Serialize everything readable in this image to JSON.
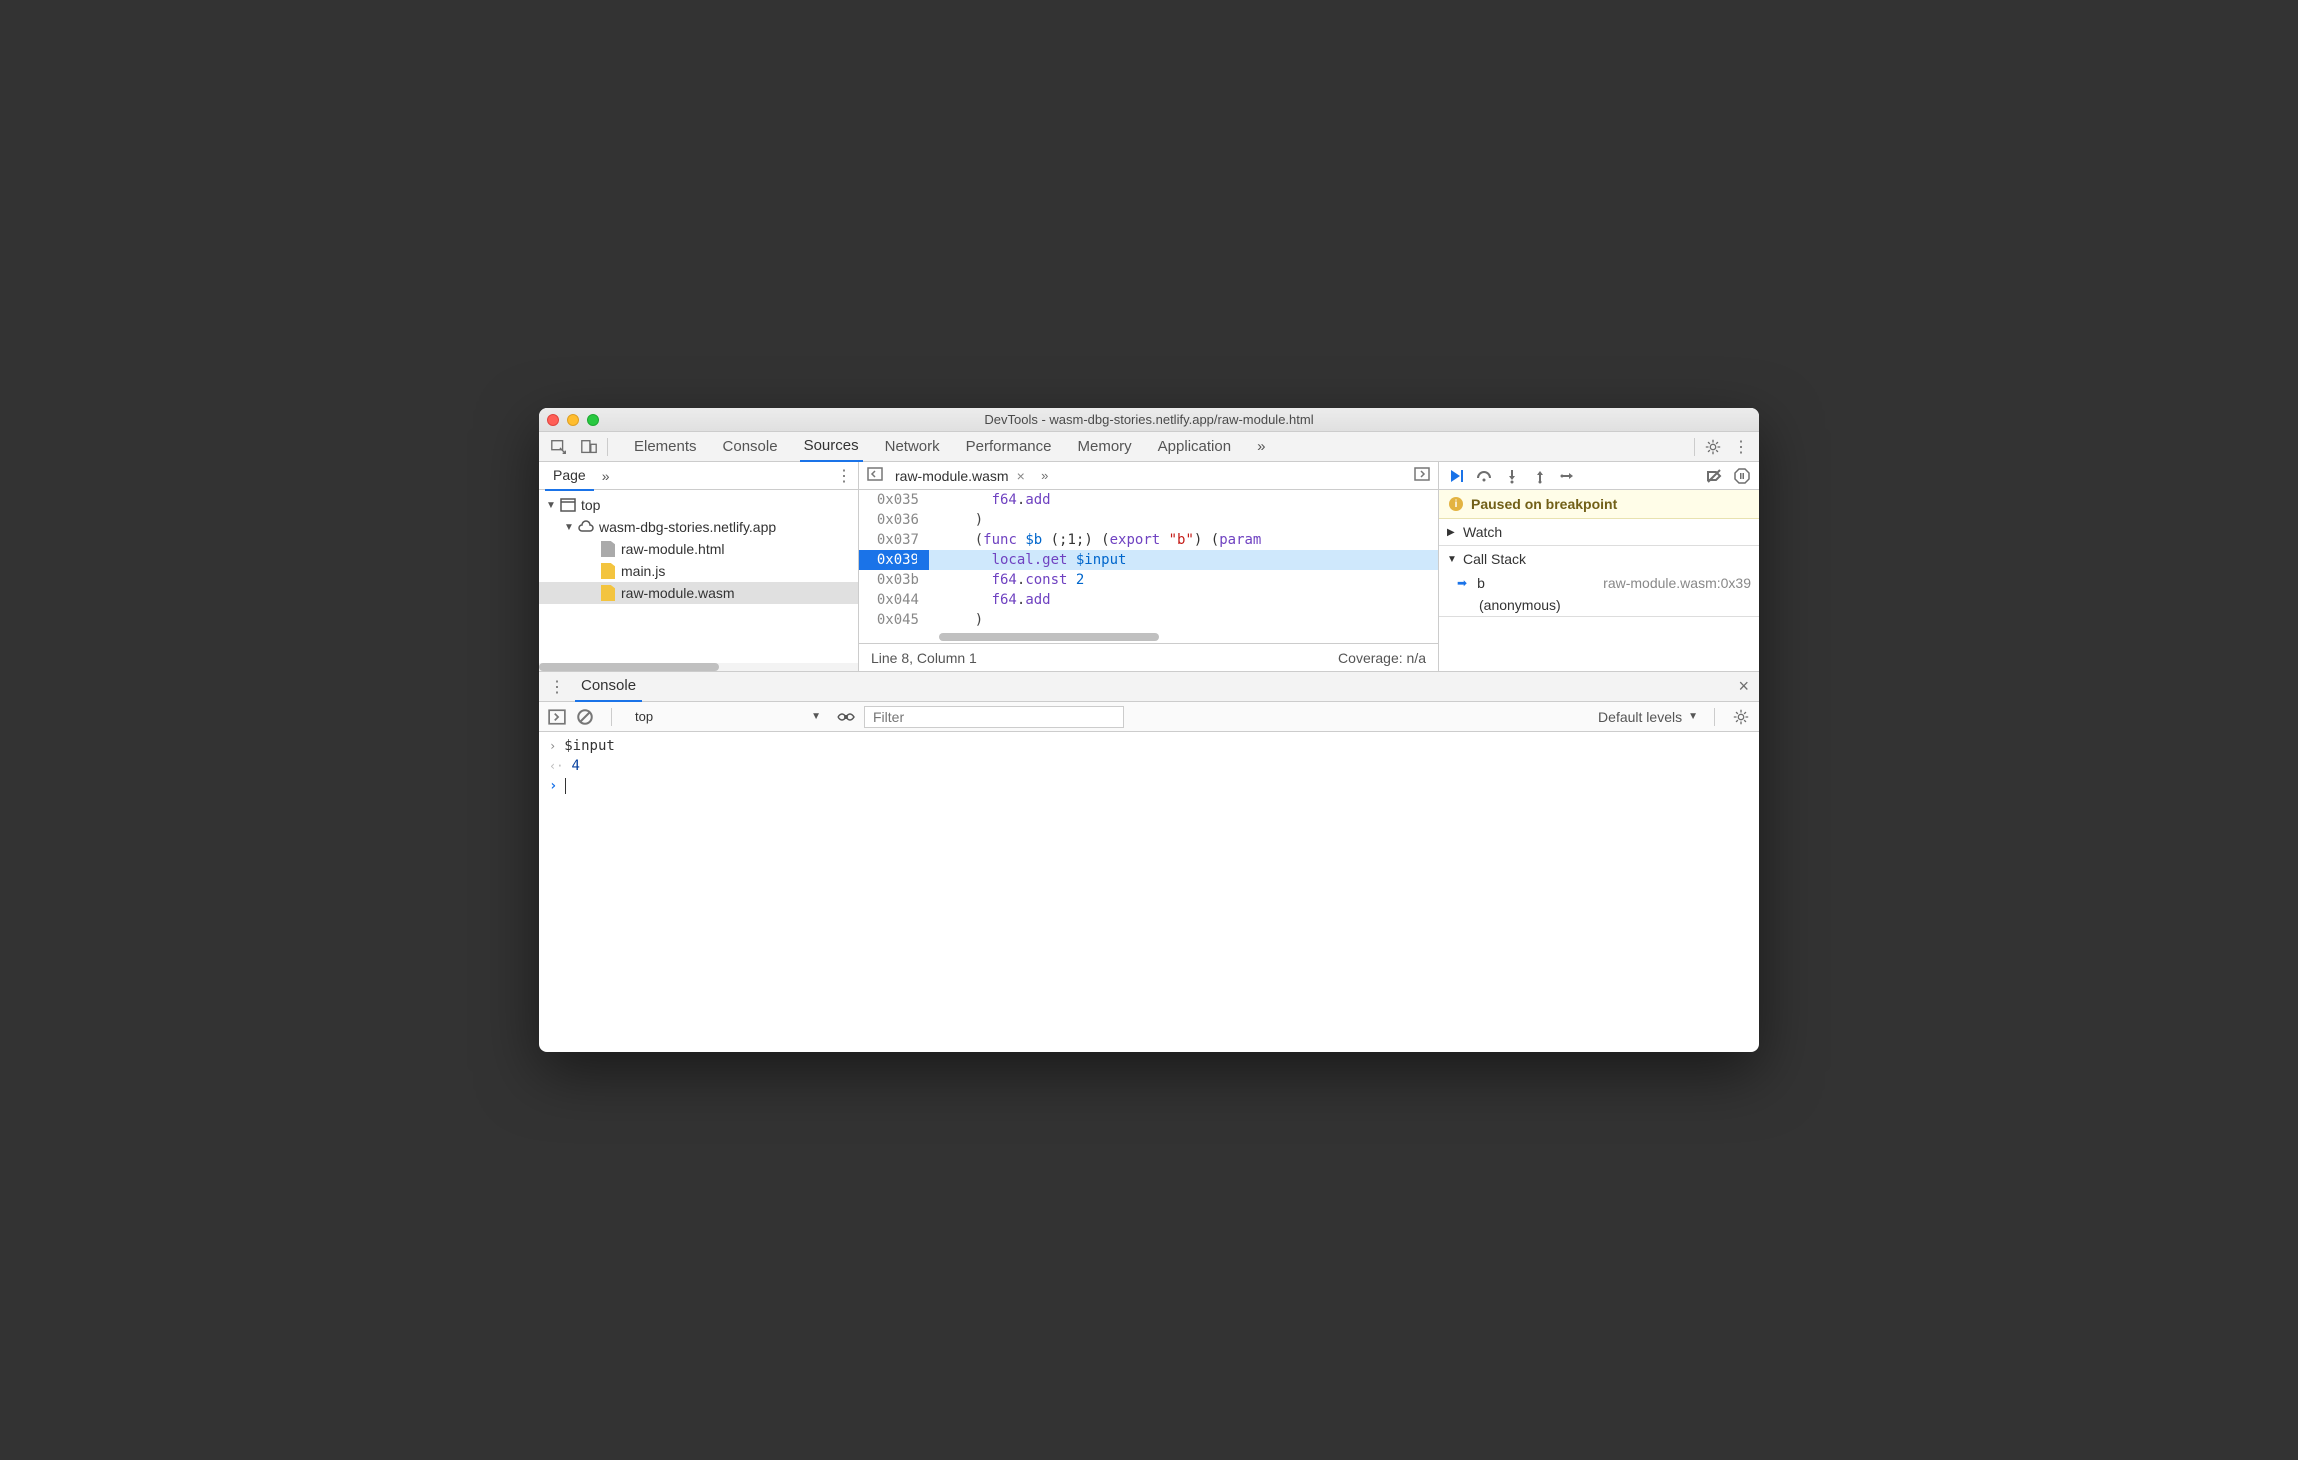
{
  "window": {
    "title": "DevTools - wasm-dbg-stories.netlify.app/raw-module.html"
  },
  "toolbar": {
    "tabs": [
      "Elements",
      "Console",
      "Sources",
      "Network",
      "Performance",
      "Memory",
      "Application"
    ],
    "active_tab": "Sources"
  },
  "nav": {
    "tab_label": "Page",
    "tree": {
      "root": "top",
      "domain": "wasm-dbg-stories.netlify.app",
      "files": [
        "raw-module.html",
        "main.js",
        "raw-module.wasm"
      ],
      "selected": "raw-module.wasm"
    }
  },
  "editor": {
    "open_file": "raw-module.wasm",
    "lines": [
      {
        "addr": "0x035",
        "tokens": [
          {
            "t": "indent",
            "v": "      "
          },
          {
            "t": "type",
            "v": "f64"
          },
          {
            "t": "op",
            "v": "."
          },
          {
            "t": "kw",
            "v": "add"
          }
        ]
      },
      {
        "addr": "0x036",
        "tokens": [
          {
            "t": "indent",
            "v": "    "
          },
          {
            "t": "op",
            "v": ")"
          }
        ]
      },
      {
        "addr": "0x037",
        "tokens": [
          {
            "t": "indent",
            "v": "    "
          },
          {
            "t": "op",
            "v": "("
          },
          {
            "t": "kw",
            "v": "func"
          },
          {
            "t": "plain",
            "v": " "
          },
          {
            "t": "var",
            "v": "$b"
          },
          {
            "t": "plain",
            "v": " (;1;) ("
          },
          {
            "t": "kw",
            "v": "export"
          },
          {
            "t": "plain",
            "v": " "
          },
          {
            "t": "str",
            "v": "\"b\""
          },
          {
            "t": "plain",
            "v": ") ("
          },
          {
            "t": "kw",
            "v": "param"
          }
        ]
      },
      {
        "addr": "0x039",
        "bp": true,
        "hl": true,
        "tokens": [
          {
            "t": "indent",
            "v": "      "
          },
          {
            "t": "kw",
            "v": "local.get"
          },
          {
            "t": "plain",
            "v": " "
          },
          {
            "t": "var",
            "v": "$input"
          }
        ]
      },
      {
        "addr": "0x03b",
        "tokens": [
          {
            "t": "indent",
            "v": "      "
          },
          {
            "t": "type",
            "v": "f64"
          },
          {
            "t": "op",
            "v": "."
          },
          {
            "t": "kw",
            "v": "const"
          },
          {
            "t": "plain",
            "v": " "
          },
          {
            "t": "num",
            "v": "2"
          }
        ]
      },
      {
        "addr": "0x044",
        "tokens": [
          {
            "t": "indent",
            "v": "      "
          },
          {
            "t": "type",
            "v": "f64"
          },
          {
            "t": "op",
            "v": "."
          },
          {
            "t": "kw",
            "v": "add"
          }
        ]
      },
      {
        "addr": "0x045",
        "tokens": [
          {
            "t": "indent",
            "v": "    "
          },
          {
            "t": "op",
            "v": ")"
          }
        ]
      }
    ],
    "status_left": "Line 8, Column 1",
    "status_right": "Coverage: n/a"
  },
  "debugger": {
    "paused_msg": "Paused on breakpoint",
    "watch_label": "Watch",
    "callstack_label": "Call Stack",
    "stack": [
      {
        "fn": "b",
        "loc": "raw-module.wasm:0x39",
        "current": true
      },
      {
        "fn": "(anonymous)",
        "loc": ""
      }
    ]
  },
  "drawer": {
    "tab_label": "Console",
    "context": "top",
    "filter_placeholder": "Filter",
    "levels_label": "Default levels",
    "rows": [
      {
        "kind": "in",
        "text": "$input"
      },
      {
        "kind": "out",
        "text": "4"
      }
    ]
  }
}
